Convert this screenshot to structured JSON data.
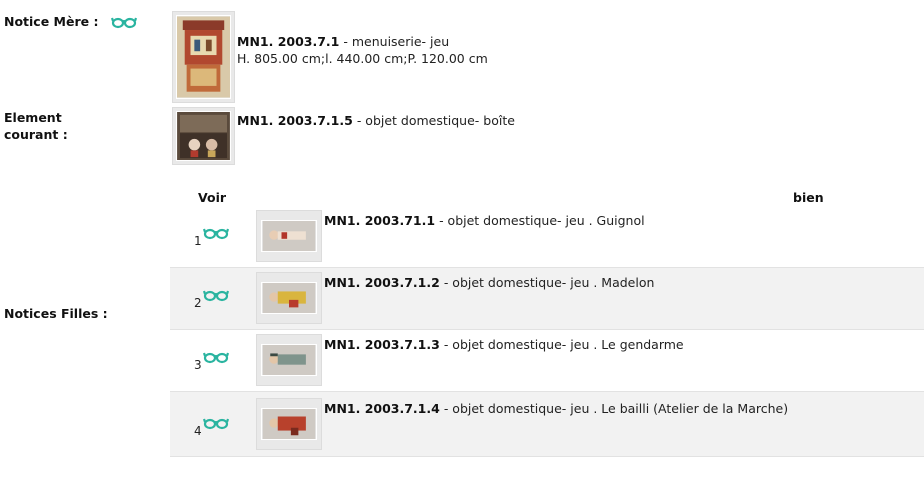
{
  "mother": {
    "label": "Notice Mère :",
    "ident": "MN1. 2003.7.1",
    "desc": "- menuiserie- jeu",
    "dims": "H. 805.00 cm;l. 440.00 cm;P. 120.00 cm"
  },
  "current": {
    "label_line1": "Element",
    "label_line2": "courant :",
    "ident": "MN1. 2003.7.1.5",
    "desc": "- objet domestique- boîte"
  },
  "children": {
    "label": "Notices Filles :",
    "col_voir": "Voir",
    "col_bien": "bien",
    "rows": [
      {
        "num": "1",
        "ident": "MN1. 2003.71.1",
        "desc": "- objet domestique- jeu . Guignol"
      },
      {
        "num": "2",
        "ident": "MN1. 2003.7.1.2",
        "desc": "- objet domestique- jeu . Madelon"
      },
      {
        "num": "3",
        "ident": "MN1. 2003.7.1.3",
        "desc": "- objet domestique- jeu . Le gendarme"
      },
      {
        "num": "4",
        "ident": "MN1. 2003.7.1.4",
        "desc": "- objet domestique- jeu . Le bailli (Atelier de la Marche)"
      }
    ]
  },
  "colors": {
    "accent": "#2ab4a0",
    "alt_row": "#f2f2f2"
  },
  "icons": {
    "view": "glasses-icon"
  }
}
